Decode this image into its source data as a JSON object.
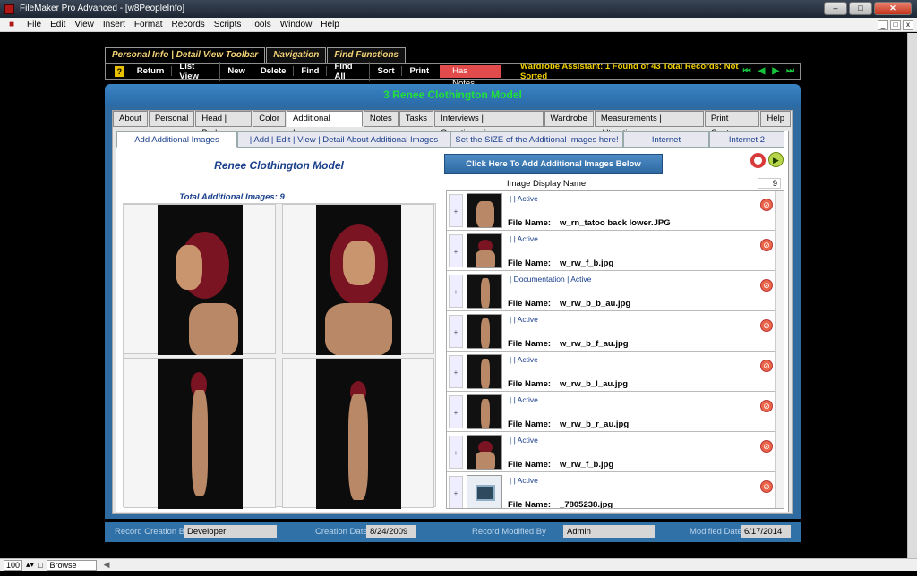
{
  "window": {
    "title": "FileMaker Pro Advanced - [w8PeopleInfo]"
  },
  "menu": [
    "File",
    "Edit",
    "View",
    "Insert",
    "Format",
    "Records",
    "Scripts",
    "Tools",
    "Window",
    "Help"
  ],
  "top_tabs": [
    "Personal Info | Detail View Toolbar",
    "Navigation",
    "Find Functions"
  ],
  "toolbar": {
    "buttons": [
      "Return",
      "List View",
      "New",
      "Delete",
      "Find",
      "Find All",
      "Sort",
      "Print"
    ],
    "has_notes": "Has Notes",
    "wardrobe": "Wardrobe Assistant:  1 Found of 43 Total Records: Not Sorted"
  },
  "record_header": "3   Renee Clothington   Model",
  "main_tabs": [
    "About",
    "Personal",
    "Head | Body",
    "Color",
    "Additional Images",
    "Notes",
    "Tasks",
    "Interviews | Questionnaires",
    "Wardrobe",
    "Measurements | Alterations",
    "Print Center",
    "Help"
  ],
  "sub_tabs": [
    "Add Additional Images",
    "| Add | Edit | View | Detail About Additional Images",
    "Set the SIZE of the Additional Images here!",
    "Internet",
    "Internet 2"
  ],
  "left": {
    "name": "Renee Clothington    Model",
    "total": "Total Additional  Images: 9"
  },
  "right": {
    "click_button": "Click Here To Add Additional Images Below",
    "image_display_name": "Image Display Name",
    "count": "9",
    "file_name_label": "File Name:",
    "rows": [
      {
        "status": "| | Active",
        "file": "w_rn_tatoo back lower.JPG"
      },
      {
        "status": "| | Active",
        "file": "w_rw_f_b.jpg"
      },
      {
        "status": "| Documentation | Active",
        "file": "w_rw_b_b_au.jpg"
      },
      {
        "status": "| | Active",
        "file": "w_rw_b_f_au.jpg"
      },
      {
        "status": "| | Active",
        "file": "w_rw_b_l_au.jpg"
      },
      {
        "status": "| | Active",
        "file": "w_rw_b_r_au.jpg"
      },
      {
        "status": "| | Active",
        "file": "w_rw_f_b.jpg"
      },
      {
        "status": "| | Active",
        "file": "_7805238.jpg"
      }
    ]
  },
  "footer": {
    "creation_by_label": "Record Creation By",
    "creation_by": "Developer",
    "creation_date_label": "Creation Date",
    "creation_date": "8/24/2009",
    "modified_by_label": "Record Modified By",
    "modified_by": "Admin",
    "modified_date_label": "Modified Date",
    "modified_date": "6/17/2014"
  },
  "statusbar": {
    "zoom": "100",
    "mode": "Browse"
  }
}
